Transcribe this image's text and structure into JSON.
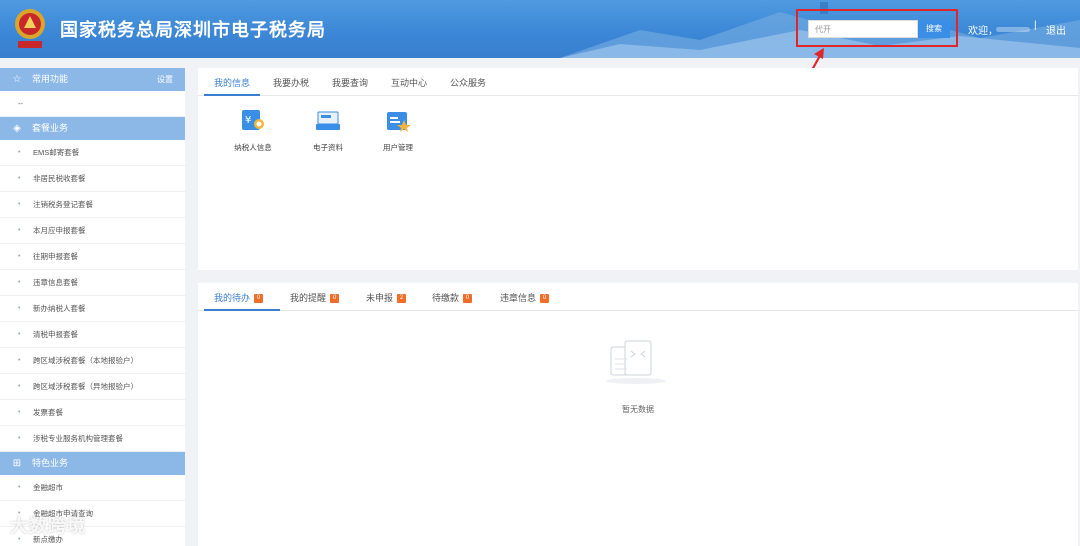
{
  "header": {
    "title": "国家税务总局深圳市电子税务局",
    "search": {
      "value": "代开",
      "button": "搜索"
    },
    "welcome": "欢迎，",
    "separator": "|",
    "logout": "退出",
    "colors": {
      "header": "#3b86d6",
      "highlight": "#e0262a"
    }
  },
  "sidebar": {
    "common": {
      "title": "常用功能",
      "settings": "设置",
      "empty": "--"
    },
    "packages": {
      "title": "套餐业务",
      "items": [
        "EMS邮寄套餐",
        "非居民税收套餐",
        "注销税务登记套餐",
        "本月应申报套餐",
        "往期申报套餐",
        "违章信息套餐",
        "新办纳税人套餐",
        "清税申报套餐",
        "跨区域涉税套餐（本地报验户）",
        "跨区域涉税套餐（异地报验户）",
        "发票套餐",
        "涉税专业服务机构管理套餐"
      ]
    },
    "special": {
      "title": "特色业务",
      "items": [
        "金融超市",
        "金融超市申请查询",
        "新点缴办"
      ]
    }
  },
  "info_panel": {
    "tabs": [
      "我的信息",
      "我要办税",
      "我要查询",
      "互动中心",
      "公众服务"
    ],
    "actions": [
      {
        "label": "纳税人信息",
        "icon": "taxpayer-info-icon"
      },
      {
        "label": "电子资料",
        "icon": "e-document-icon"
      },
      {
        "label": "用户管理",
        "icon": "user-management-icon"
      }
    ]
  },
  "task_panel": {
    "tabs": [
      {
        "label": "我的待办",
        "count": "0"
      },
      {
        "label": "我的提醒",
        "count": "0"
      },
      {
        "label": "未申报",
        "count": "2"
      },
      {
        "label": "待缴款",
        "count": "0"
      },
      {
        "label": "违章信息",
        "count": "0"
      }
    ],
    "empty": "暂无数据"
  },
  "watermark": "大数跨境"
}
